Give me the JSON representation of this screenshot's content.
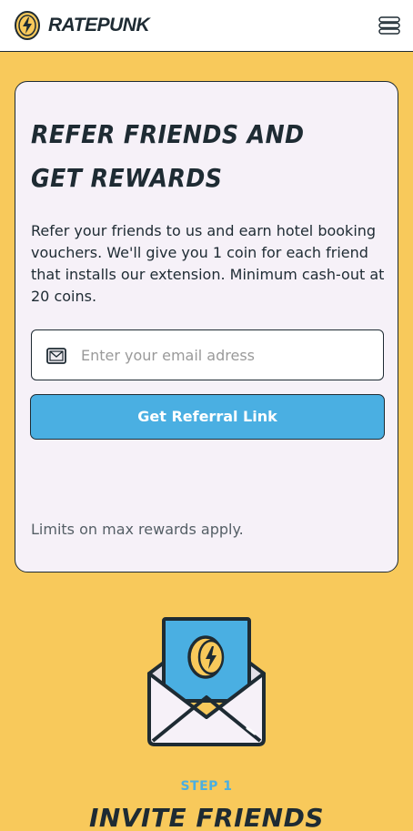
{
  "header": {
    "brand": "RATEPUNK",
    "logo_icon": "lightning-coin-icon",
    "menu_icon": "hamburger-menu-icon"
  },
  "card": {
    "title": "Refer friends and get rewards",
    "description": "Refer your friends to us and earn hotel booking vouchers. We'll give you 1 coin for each friend that installs our extension. Minimum cash-out at 20 coins.",
    "email": {
      "icon": "mail-icon",
      "placeholder": "Enter your email adress",
      "value": ""
    },
    "button_label": "Get Referral Link",
    "limits_note": "Limits on max rewards apply."
  },
  "step": {
    "icon": "envelope-coin-icon",
    "label": "STEP 1",
    "title": "Invite friends"
  },
  "colors": {
    "background": "#f8c95b",
    "card": "#f6f1f8",
    "accent_blue": "#4aafe2",
    "ink": "#1e2b33"
  }
}
